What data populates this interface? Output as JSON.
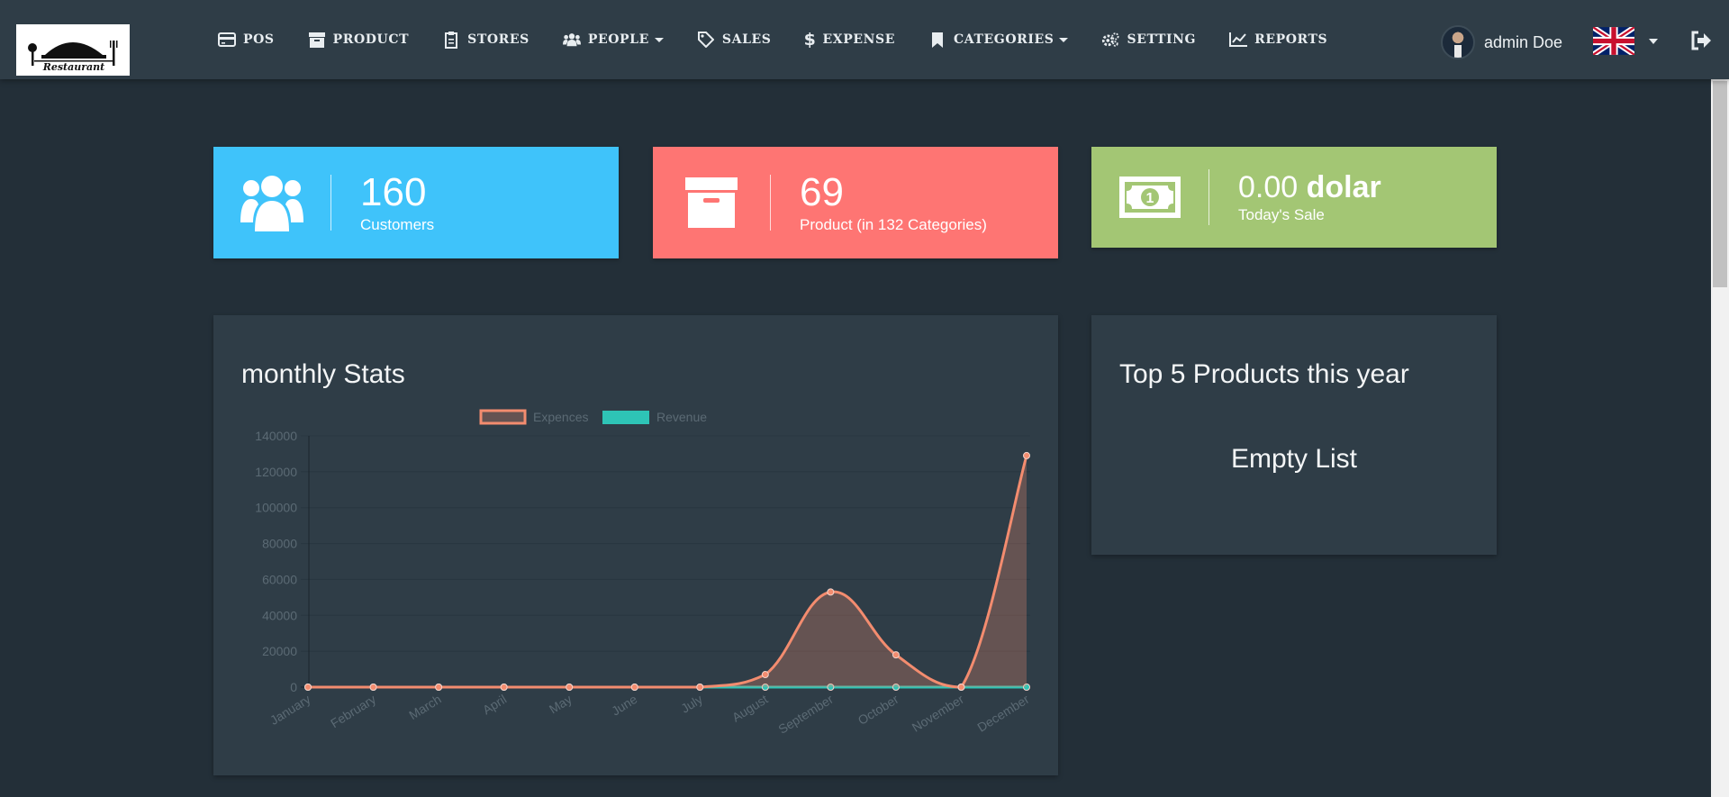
{
  "logo": {
    "text": "Restaurant"
  },
  "nav": [
    {
      "label": "POS",
      "icon": "credit-card-icon"
    },
    {
      "label": "PRODUCT",
      "icon": "archive-icon"
    },
    {
      "label": "STORES",
      "icon": "clipboard-icon"
    },
    {
      "label": "PEOPLE",
      "icon": "users-icon",
      "dropdown": true
    },
    {
      "label": "SALES",
      "icon": "tag-icon"
    },
    {
      "label": "EXPENSE",
      "icon": "dollar-icon"
    },
    {
      "label": "CATEGORIES",
      "icon": "bookmark-icon",
      "dropdown": true
    },
    {
      "label": "SETTING",
      "icon": "cogs-icon"
    },
    {
      "label": "REPORTS",
      "icon": "line-chart-icon"
    }
  ],
  "user": {
    "name": "admin Doe"
  },
  "stats": {
    "customers": {
      "value": "160",
      "label": "Customers"
    },
    "products": {
      "value": "69",
      "label": "Product (in 132 Categories)"
    },
    "sales": {
      "value": "0.00",
      "unit": "dolar",
      "label": "Today's Sale"
    }
  },
  "monthly": {
    "title": "monthly Stats"
  },
  "top_products": {
    "title": "Top 5 Products this year",
    "empty": "Empty List"
  },
  "colors": {
    "customers": "#3fc3fa",
    "products": "#fe7573",
    "sales": "#a3c674",
    "expences": "#f38c6f",
    "revenue": "#2ec4b6"
  },
  "chart_data": {
    "type": "area",
    "categories": [
      "January",
      "February",
      "March",
      "April",
      "May",
      "June",
      "July",
      "August",
      "September",
      "October",
      "November",
      "December"
    ],
    "series": [
      {
        "name": "Expences",
        "values": [
          0,
          0,
          0,
          0,
          0,
          0,
          0,
          7000,
          53000,
          18000,
          0,
          129000
        ]
      },
      {
        "name": "Revenue",
        "values": [
          0,
          0,
          0,
          0,
          0,
          0,
          0,
          0,
          0,
          0,
          0,
          0
        ]
      }
    ],
    "yticks": [
      "0",
      "20000",
      "40000",
      "60000",
      "80000",
      "100000",
      "120000",
      "140000"
    ],
    "ylim": [
      0,
      140000
    ],
    "legend": "top",
    "grid": true
  }
}
